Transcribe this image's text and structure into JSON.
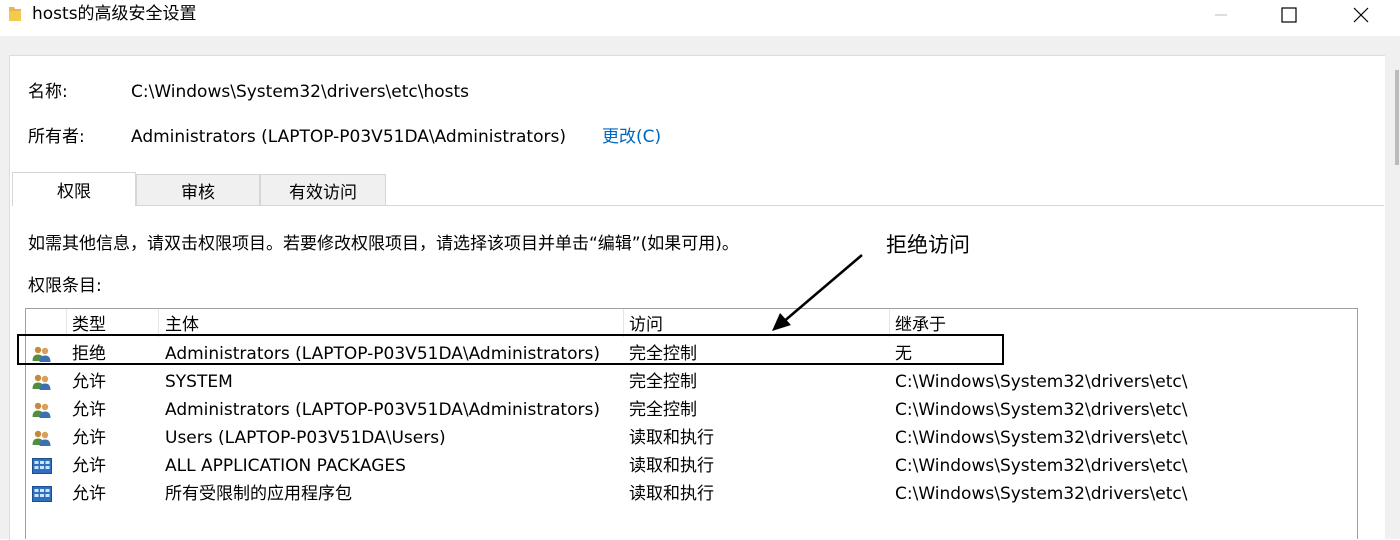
{
  "window": {
    "title": "hosts的高级安全设置"
  },
  "info": {
    "name_label": "名称:",
    "name_value": "C:\\Windows\\System32\\drivers\\etc\\hosts",
    "owner_label": "所有者:",
    "owner_value": "Administrators (LAPTOP-P03V51DA\\Administrators)",
    "change_link": "更改(C)"
  },
  "tabs": [
    {
      "label": "权限",
      "active": true
    },
    {
      "label": "审核",
      "active": false
    },
    {
      "label": "有效访问",
      "active": false
    }
  ],
  "permissions": {
    "hint": "如需其他信息，请双击权限项目。若要修改权限项目，请选择该项目并单击“编辑”(如果可用)。",
    "entries_label": "权限条目:",
    "columns": [
      "类型",
      "主体",
      "访问",
      "继承于"
    ],
    "rows": [
      {
        "icon": "users-icon",
        "type": "拒绝",
        "principal": "Administrators (LAPTOP-P03V51DA\\Administrators)",
        "access": "完全控制",
        "inherited": "无"
      },
      {
        "icon": "users-icon",
        "type": "允许",
        "principal": "SYSTEM",
        "access": "完全控制",
        "inherited": "C:\\Windows\\System32\\drivers\\etc\\"
      },
      {
        "icon": "users-icon",
        "type": "允许",
        "principal": "Administrators (LAPTOP-P03V51DA\\Administrators)",
        "access": "完全控制",
        "inherited": "C:\\Windows\\System32\\drivers\\etc\\"
      },
      {
        "icon": "users-icon",
        "type": "允许",
        "principal": "Users (LAPTOP-P03V51DA\\Users)",
        "access": "读取和执行",
        "inherited": "C:\\Windows\\System32\\drivers\\etc\\"
      },
      {
        "icon": "app-packages-icon",
        "type": "允许",
        "principal": "ALL APPLICATION PACKAGES",
        "access": "读取和执行",
        "inherited": "C:\\Windows\\System32\\drivers\\etc\\"
      },
      {
        "icon": "app-packages-icon",
        "type": "允许",
        "principal": "所有受限制的应用程序包",
        "access": "读取和执行",
        "inherited": "C:\\Windows\\System32\\drivers\\etc\\"
      }
    ]
  },
  "annotation": {
    "text": "拒绝访问"
  }
}
